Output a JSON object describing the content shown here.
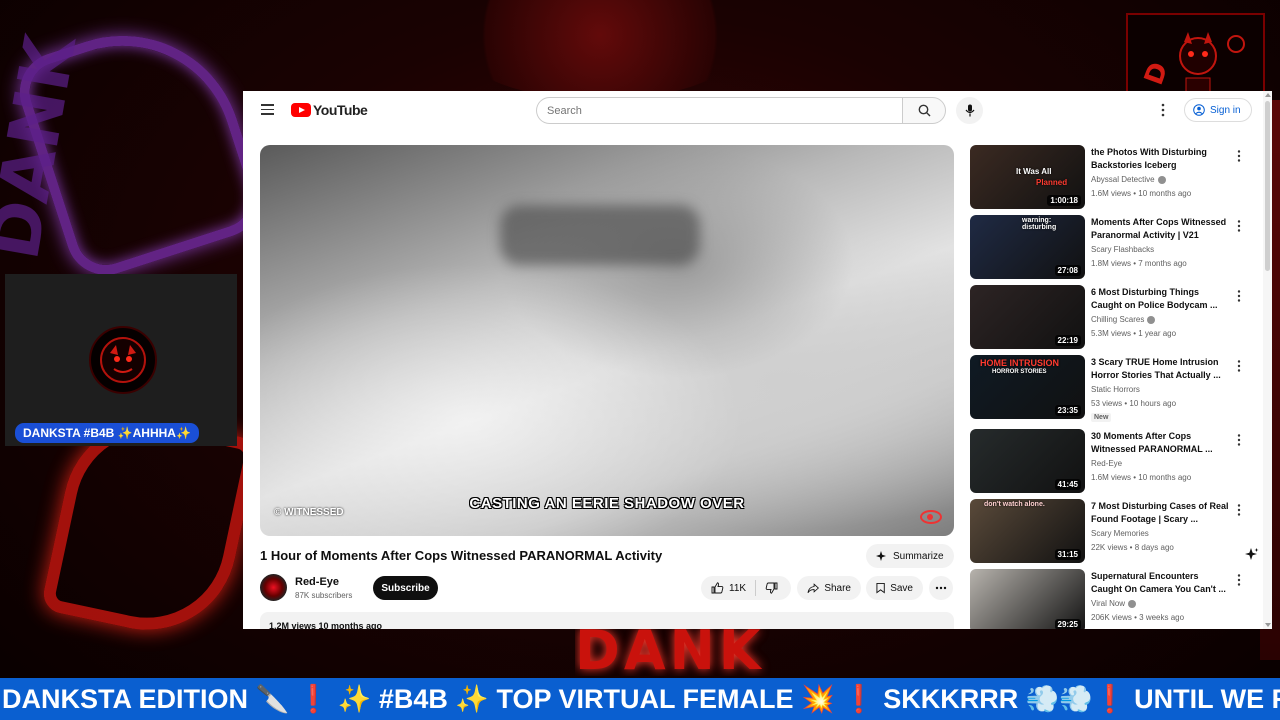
{
  "overlay": {
    "cam_label": "DANKSTA #B4B ✨AHHHA✨",
    "ticker": "DANKSTA EDITION 🔪 ❗ ✨ #B4B ✨ TOP VIRTUAL FEMALE 💥 ❗ SKKKRRR 💨💨❗ UNTIL WE REALLY",
    "bg_word": "DANK",
    "bg_word_side": "DANK"
  },
  "header": {
    "logo_text": "YouTube",
    "search_placeholder": "Search",
    "signin_label": "Sign in"
  },
  "player": {
    "watermark": "© WITNESSED",
    "subtitle": "CASTING AN EERIE SHADOW OVER"
  },
  "video": {
    "title": "1 Hour of Moments After Cops Witnessed PARANORMAL Activity",
    "summarize_label": "Summarize",
    "channel": "Red-Eye",
    "subscribers": "87K subscribers",
    "subscribe_label": "Subscribe",
    "likes": "11K",
    "share_label": "Share",
    "save_label": "Save",
    "views_date": "1.2M views  10 months ago"
  },
  "recommendations": [
    {
      "title": "the Photos With Disturbing Backstories Iceberg",
      "channel": "Abyssal Detective",
      "verified": true,
      "meta": "1.6M views • 10 months ago",
      "duration": "1:00:18",
      "thumb_text": "It Was All",
      "thumb_text2": "Planned",
      "new": false,
      "thumb_bg": "#3b2a22"
    },
    {
      "title": "Moments After Cops Witnessed Paranormal Activity | V21",
      "channel": "Scary Flashbacks",
      "verified": false,
      "meta": "1.8M views • 7 months ago",
      "duration": "27:08",
      "thumb_text": "warning: disturbing",
      "thumb_text2": "",
      "new": false,
      "thumb_bg": "#1f2a44"
    },
    {
      "title": "6 Most Disturbing Things Caught on Police Bodycam ...",
      "channel": "Chilling Scares",
      "verified": true,
      "meta": "5.3M views • 1 year ago",
      "duration": "22:19",
      "thumb_text": "",
      "thumb_text2": "",
      "new": false,
      "thumb_bg": "#2d2424"
    },
    {
      "title": "3 Scary TRUE Home Intrusion Horror Stories That Actually ...",
      "channel": "Static Horrors",
      "verified": false,
      "meta": "53 views • 10 hours ago",
      "duration": "23:35",
      "thumb_text": "HOME INTRUSION",
      "thumb_text2": "HORROR STORIES",
      "new": true,
      "new_label": "New",
      "thumb_bg": "#0f1a24"
    },
    {
      "title": "30 Moments After Cops Witnessed PARANORMAL ...",
      "channel": "Red-Eye",
      "verified": false,
      "meta": "1.6M views • 10 months ago",
      "duration": "41:45",
      "thumb_text": "",
      "thumb_text2": "",
      "new": false,
      "thumb_bg": "#262b2c"
    },
    {
      "title": "7 Most Disturbing Cases of Real Found Footage | Scary ...",
      "channel": "Scary Memories",
      "verified": false,
      "meta": "22K views • 8 days ago",
      "duration": "31:15",
      "thumb_text": "don't watch alone.",
      "thumb_text2": "",
      "new": false,
      "thumb_bg": "#5a4a3a"
    },
    {
      "title": "Supernatural Encounters Caught On Camera You Can't ...",
      "channel": "Viral Now",
      "verified": true,
      "meta": "206K views • 3 weeks ago",
      "duration": "29:25",
      "thumb_text": "",
      "thumb_text2": "",
      "new": false,
      "thumb_bg": "#b7b3ad"
    }
  ],
  "colors": {
    "accent_red": "#ff0000",
    "ticker_blue": "#0a5fd0",
    "link_blue": "#065fd4"
  }
}
